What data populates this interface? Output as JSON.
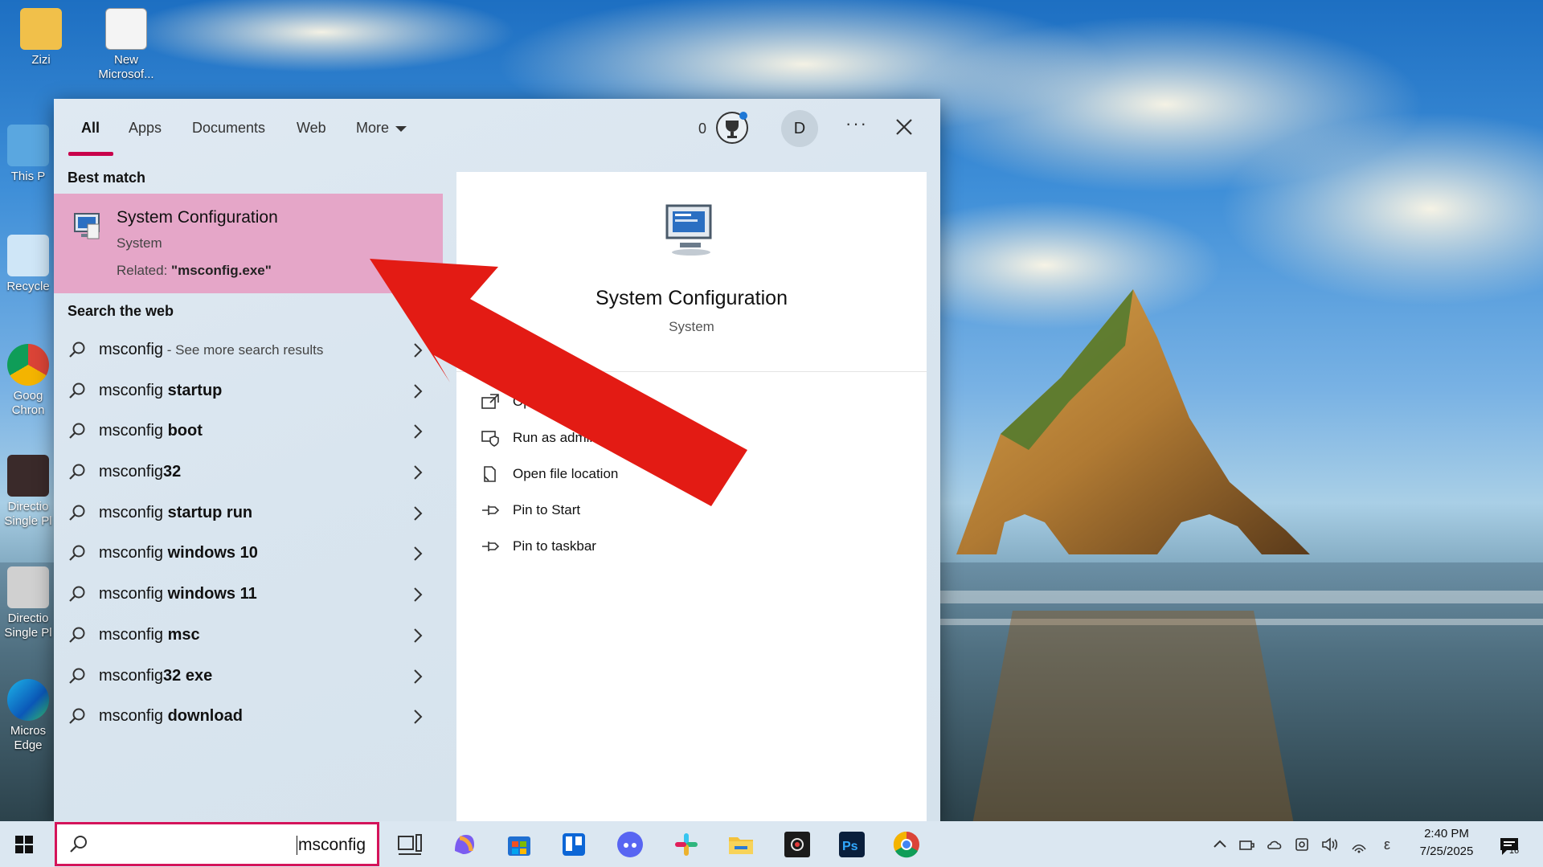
{
  "desktop_icons": [
    {
      "name": "folder-user-icon",
      "label": "Zizi"
    },
    {
      "name": "word-document-icon",
      "label": "New Microsof..."
    },
    {
      "name": "this-pc-icon",
      "label": "This P"
    },
    {
      "name": "recycle-bin-icon",
      "label": "Recycle"
    },
    {
      "name": "chrome-icon",
      "label": "Goog Chron"
    },
    {
      "name": "shortcut-icon",
      "label": "Directio Single Pl"
    },
    {
      "name": "shortcut-icon",
      "label": "Directio Single Pl"
    },
    {
      "name": "edge-icon",
      "label": "Micros Edge"
    }
  ],
  "search_panel": {
    "tabs": [
      {
        "label": "All",
        "active": true
      },
      {
        "label": "Apps"
      },
      {
        "label": "Documents"
      },
      {
        "label": "Web"
      },
      {
        "label": "More"
      }
    ],
    "rewards_count": "0",
    "avatar_initial": "D",
    "more_options": "···",
    "best_match_label": "Best match",
    "best_match": {
      "title": "System Configuration",
      "subtitle": "System",
      "related_prefix": "Related: ",
      "related_value": "\"msconfig.exe\""
    },
    "search_web_label": "Search the web",
    "web_results": [
      {
        "prefix": "msconfig",
        "bold": "",
        "hint": " - See more search results"
      },
      {
        "prefix": "msconfig ",
        "bold": "startup",
        "hint": ""
      },
      {
        "prefix": "msconfig ",
        "bold": "boot",
        "hint": ""
      },
      {
        "prefix": "msconfig",
        "bold": "32",
        "hint": ""
      },
      {
        "prefix": "msconfig ",
        "bold": "startup run",
        "hint": ""
      },
      {
        "prefix": "msconfig ",
        "bold": "windows 10",
        "hint": ""
      },
      {
        "prefix": "msconfig ",
        "bold": "windows 11",
        "hint": ""
      },
      {
        "prefix": "msconfig ",
        "bold": "msc",
        "hint": ""
      },
      {
        "prefix": "msconfig",
        "bold": "32 exe",
        "hint": ""
      },
      {
        "prefix": "msconfig ",
        "bold": "download",
        "hint": ""
      }
    ],
    "preview": {
      "title": "System Configuration",
      "subtitle": "System",
      "actions": [
        {
          "label": "Open",
          "icon": "open-icon"
        },
        {
          "label": "Run as administ",
          "icon": "shield-admin-icon"
        },
        {
          "label": "Open file location",
          "icon": "file-location-icon"
        },
        {
          "label": "Pin to Start",
          "icon": "pin-icon"
        },
        {
          "label": "Pin to taskbar",
          "icon": "pin-icon"
        }
      ]
    }
  },
  "taskbar": {
    "search_value": "msconfig",
    "clock_time": "2:40 PM",
    "clock_date": "7/25/2025",
    "notification_count": "16",
    "language_indicator": "ε",
    "accent_color": "#d4145a"
  }
}
